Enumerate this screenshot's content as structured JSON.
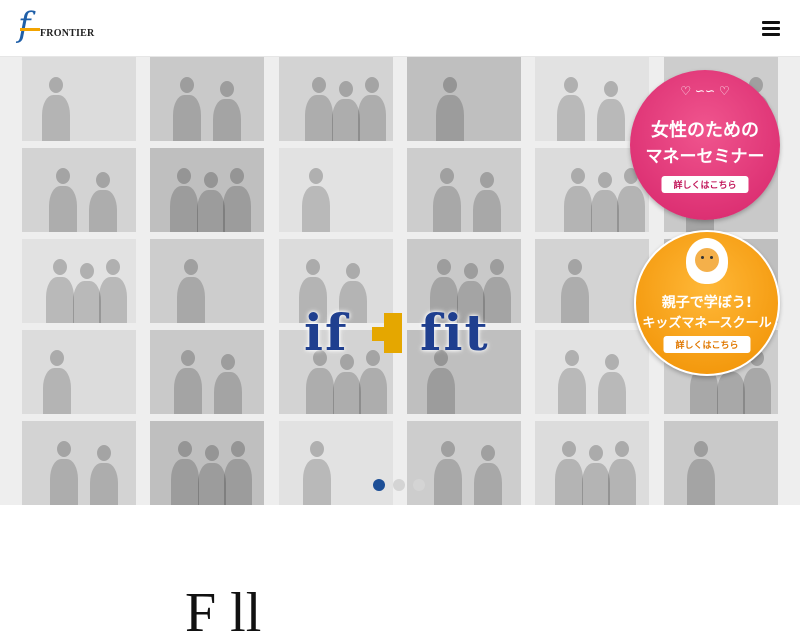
{
  "header": {
    "logo_mark": "f",
    "logo_text": "FRONTIER",
    "menu_icon": "hamburger-icon"
  },
  "hero": {
    "logo_left": "if",
    "logo_right": "fit",
    "banners": [
      {
        "name": "womens-seminar",
        "line1": "女性のための",
        "line2": "マネーセミナー",
        "button": "詳しくはこちら",
        "ornament": "♡ ∽∽ ♡",
        "color": "#e0356f"
      },
      {
        "name": "kids-money-school",
        "line1": "親子で学ぼう!",
        "line2": "キッズマネースクール",
        "button": "詳しくはこちら",
        "color": "#f29a00"
      }
    ],
    "carousel": {
      "slides": 3,
      "active": 1
    }
  },
  "section": {
    "heading_partial": "F   ll"
  },
  "colors": {
    "brand_blue": "#1f5fa8",
    "brand_gold": "#e5a700",
    "dot_active": "#1d4f97"
  }
}
